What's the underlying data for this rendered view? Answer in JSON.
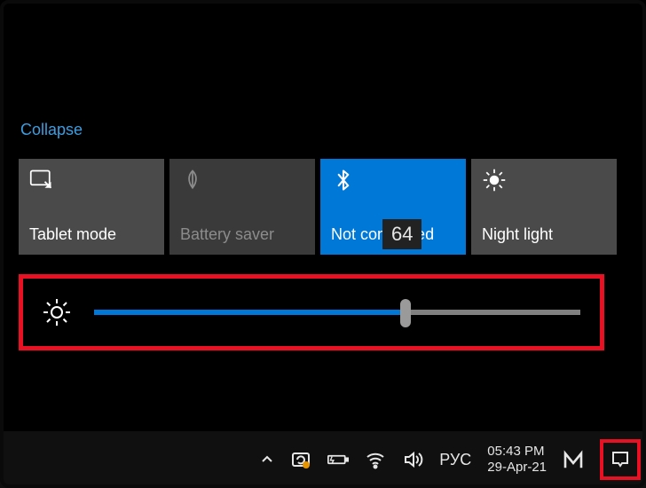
{
  "collapse_label": "Collapse",
  "tiles": {
    "tablet": {
      "label": "Tablet mode"
    },
    "battery": {
      "label": "Battery saver"
    },
    "bluetooth": {
      "label": "Not connected"
    },
    "night": {
      "label": "Night light"
    }
  },
  "brightness": {
    "value": 64,
    "tooltip": "64"
  },
  "tray": {
    "ime": "РУС",
    "time": "05:43 PM",
    "date": "29-Apr-21"
  },
  "colors": {
    "accent": "#0078d7",
    "highlight_border": "#e81123"
  }
}
